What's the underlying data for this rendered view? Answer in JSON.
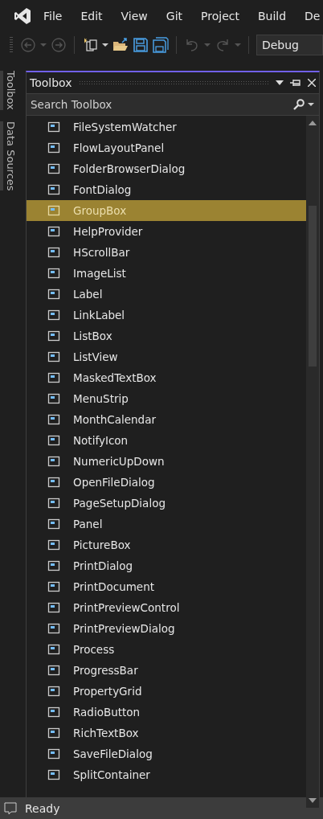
{
  "menu": [
    "File",
    "Edit",
    "View",
    "Git",
    "Project",
    "Build",
    "De"
  ],
  "toolbar": {
    "configuration": "Debug"
  },
  "side_tabs": [
    {
      "label": "Toolbox"
    },
    {
      "label": "Data Sources"
    }
  ],
  "toolbox": {
    "title": "Toolbox",
    "search": {
      "placeholder": "Search Toolbox"
    },
    "items": [
      {
        "label": "FileSystemWatcher",
        "selected": false
      },
      {
        "label": "FlowLayoutPanel",
        "selected": false
      },
      {
        "label": "FolderBrowserDialog",
        "selected": false
      },
      {
        "label": "FontDialog",
        "selected": false
      },
      {
        "label": "GroupBox",
        "selected": true
      },
      {
        "label": "HelpProvider",
        "selected": false
      },
      {
        "label": "HScrollBar",
        "selected": false
      },
      {
        "label": "ImageList",
        "selected": false
      },
      {
        "label": "Label",
        "selected": false
      },
      {
        "label": "LinkLabel",
        "selected": false
      },
      {
        "label": "ListBox",
        "selected": false
      },
      {
        "label": "ListView",
        "selected": false
      },
      {
        "label": "MaskedTextBox",
        "selected": false
      },
      {
        "label": "MenuStrip",
        "selected": false
      },
      {
        "label": "MonthCalendar",
        "selected": false
      },
      {
        "label": "NotifyIcon",
        "selected": false
      },
      {
        "label": "NumericUpDown",
        "selected": false
      },
      {
        "label": "OpenFileDialog",
        "selected": false
      },
      {
        "label": "PageSetupDialog",
        "selected": false
      },
      {
        "label": "Panel",
        "selected": false
      },
      {
        "label": "PictureBox",
        "selected": false
      },
      {
        "label": "PrintDialog",
        "selected": false
      },
      {
        "label": "PrintDocument",
        "selected": false
      },
      {
        "label": "PrintPreviewControl",
        "selected": false
      },
      {
        "label": "PrintPreviewDialog",
        "selected": false
      },
      {
        "label": "Process",
        "selected": false
      },
      {
        "label": "ProgressBar",
        "selected": false
      },
      {
        "label": "PropertyGrid",
        "selected": false
      },
      {
        "label": "RadioButton",
        "selected": false
      },
      {
        "label": "RichTextBox",
        "selected": false
      },
      {
        "label": "SaveFileDialog",
        "selected": false
      },
      {
        "label": "SplitContainer",
        "selected": false
      }
    ]
  },
  "status_bar": {
    "text": "Ready"
  }
}
